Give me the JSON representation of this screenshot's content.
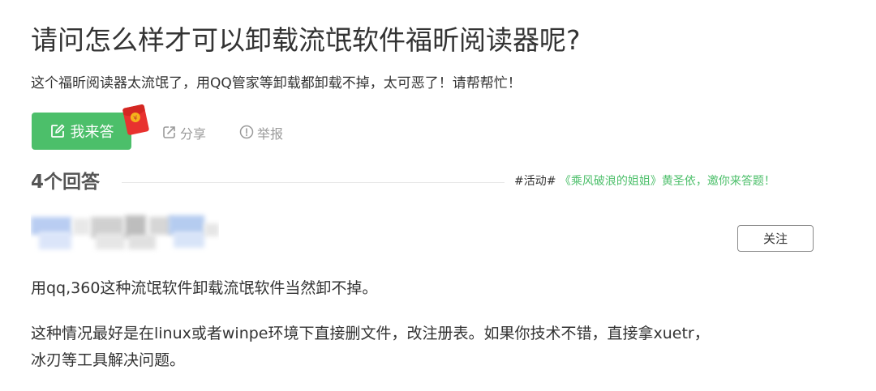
{
  "question": {
    "title": "请问怎么样才可以卸载流氓软件福昕阅读器呢?",
    "description": "这个福昕阅读器太流氓了，用QQ管家等卸载都卸载不掉，太可恶了！请帮帮忙！"
  },
  "actions": {
    "answer_label": "我来答",
    "share_label": "分享",
    "report_label": "举报"
  },
  "answers_header": {
    "count_label": "4个回答",
    "activity_tag": "#活动#",
    "activity_text": "《乘风破浪的姐姐》黄圣依，邀你来答题！"
  },
  "answer": {
    "follow_label": "关注",
    "paragraph_1": "用qq,360这种流氓软件卸载流氓软件当然卸不掉。",
    "paragraph_2_line_1": "这种情况最好是在linux或者winpe环境下直接删文件，改注册表。如果你技术不错，直接拿xuetr，",
    "paragraph_2_line_2": "冰刃等工具解决问题。"
  },
  "colors": {
    "accent_green": "#4cbf6a",
    "muted_gray": "#9a9a9a",
    "text": "#333333",
    "red_packet": "#e8322f",
    "red_packet_seal": "#f5b21b"
  },
  "icons": {
    "answer": "edit-icon",
    "red_packet": "red-packet-icon",
    "share": "share-icon",
    "report": "report-icon"
  }
}
